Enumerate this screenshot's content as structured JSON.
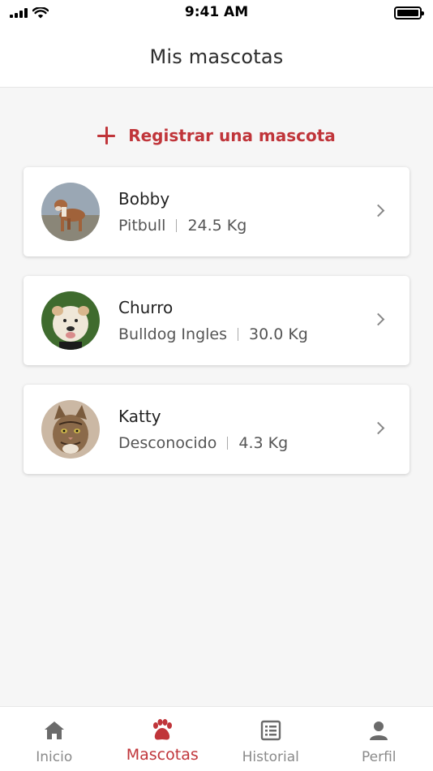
{
  "status_bar": {
    "time": "9:41 AM"
  },
  "header": {
    "title": "Mis mascotas"
  },
  "add_pet": {
    "label": "Registrar una mascota",
    "icon": "plus-icon",
    "color": "#c0353a"
  },
  "pets": [
    {
      "name": "Bobby",
      "breed": "Pitbull",
      "weight": "24.5 Kg",
      "photo": "dog-photo"
    },
    {
      "name": "Churro",
      "breed": "Bulldog Ingles",
      "weight": "30.0 Kg",
      "photo": "bulldog-photo"
    },
    {
      "name": "Katty",
      "breed": "Desconocido",
      "weight": "4.3 Kg",
      "photo": "cat-photo"
    }
  ],
  "tabs": [
    {
      "label": "Inicio",
      "icon": "home-icon",
      "active": false
    },
    {
      "label": "Mascotas",
      "icon": "paw-icon",
      "active": true
    },
    {
      "label": "Historial",
      "icon": "list-icon",
      "active": false
    },
    {
      "label": "Perfil",
      "icon": "user-icon",
      "active": false
    }
  ],
  "colors": {
    "accent": "#c0353a",
    "inactive": "#6b6b6b"
  }
}
